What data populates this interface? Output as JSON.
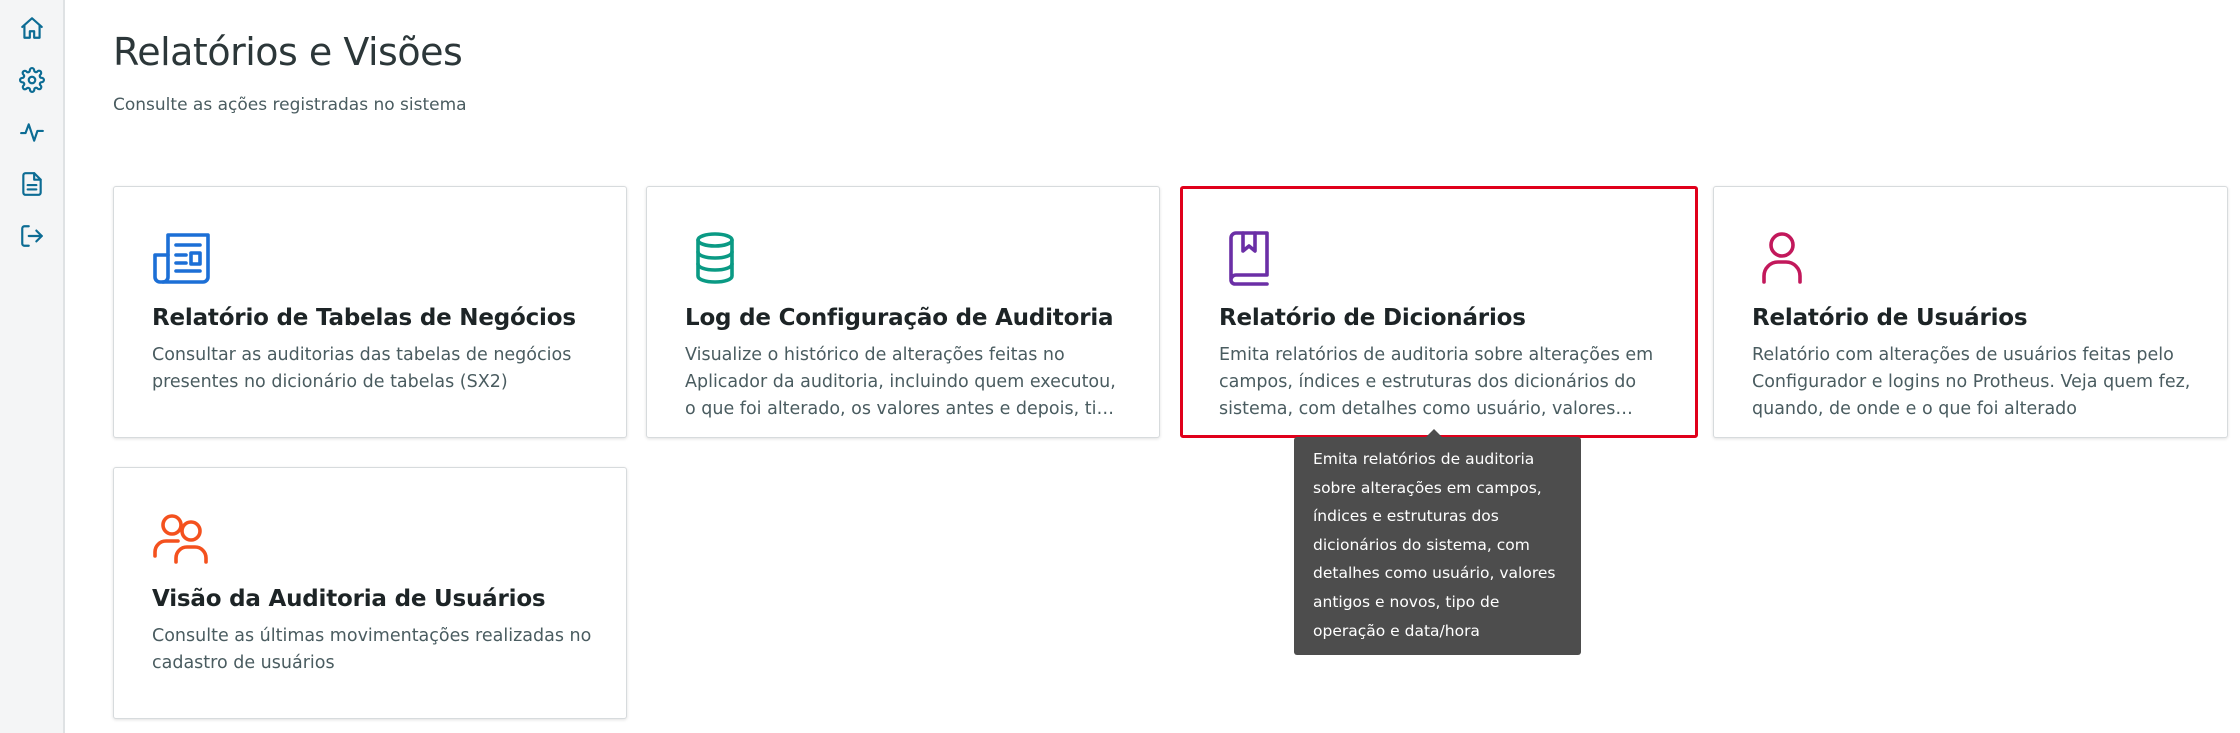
{
  "page": {
    "title": "Relatórios e Visões",
    "subtitle": "Consulte as ações registradas no sistema"
  },
  "sidebar": {
    "items": [
      {
        "icon": "home-icon"
      },
      {
        "icon": "gear-icon"
      },
      {
        "icon": "activity-icon"
      },
      {
        "icon": "document-icon"
      },
      {
        "icon": "logout-icon"
      }
    ]
  },
  "cards": [
    {
      "icon": "newspaper-icon",
      "icon_color": "#1c6fd6",
      "title": "Relatório de Tabelas de Negócios",
      "description": "Consultar as auditorias das tabelas de negócios presentes no dicionário de tabelas (SX2)"
    },
    {
      "icon": "database-icon",
      "icon_color": "#0a9a84",
      "title": "Log de Configuração de Auditoria",
      "description": "Visualize o histórico de alterações feitas no Aplicador da auditoria, incluindo quem executou, o que foi alterado, os valores antes e depois, tipo de operação e data/hora"
    },
    {
      "icon": "book-bookmark-icon",
      "icon_color": "#6b2fa6",
      "title": "Relatório de Dicionários",
      "description": "Emita relatórios de auditoria sobre alterações em campos, índices e estruturas dos dicionários do sistema, com detalhes como usuário, valores antigos e novos, tipo de operação e data/hora"
    },
    {
      "icon": "user-icon",
      "icon_color": "#c2185b",
      "title": "Relatório de Usuários",
      "description": "Relatório com alterações de usuários feitas pelo Configurador e logins no Protheus. Veja quem fez, quando, de onde e o que foi alterado"
    },
    {
      "icon": "users-icon",
      "icon_color": "#f4511e",
      "title": "Visão da Auditoria de Usuários",
      "description": "Consulte as últimas movimentações realizadas no cadastro de usuários"
    }
  ],
  "tooltip": {
    "text": "Emita relatórios de auditoria sobre alterações em campos, índices e estruturas dos dicionários do sistema, com detalhes como usuário, valores antigos e novos, tipo de operação e data/hora"
  },
  "colors": {
    "sidebar_icon": "#0c6c94",
    "highlight_border": "#e0001b",
    "tooltip_bg": "#4d4d4d"
  }
}
